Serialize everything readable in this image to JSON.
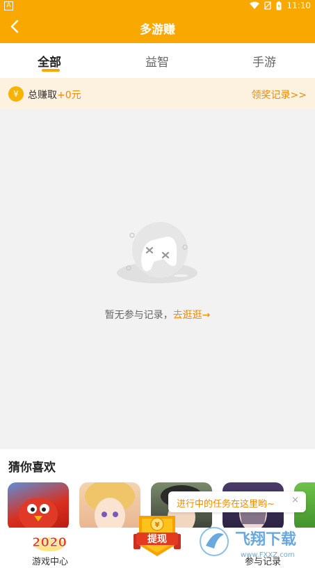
{
  "statusbar": {
    "indicator": "A",
    "time": "11:10"
  },
  "appbar": {
    "title": "多游赚"
  },
  "tabs": [
    {
      "label": "全部"
    },
    {
      "label": "益智"
    },
    {
      "label": "手游"
    }
  ],
  "earn": {
    "coin_symbol": "¥",
    "label": "总赚取",
    "value": "+0元",
    "record_link": "领奖记录>>"
  },
  "empty": {
    "text": "暂无参与记录，",
    "link": "去逛逛→"
  },
  "guess": {
    "title": "猜你喜欢"
  },
  "bottom_nav": {
    "left_label": "游戏中心",
    "left_badge": "2020",
    "center_label": "提现",
    "right_label": "参与记录"
  },
  "tooltip": {
    "text": "进行中的任务在这里哟~",
    "close": "×"
  },
  "watermark": {
    "brand": "飞翔下载",
    "url": "www.FXXZ.com"
  },
  "colors": {
    "primary": "#f8a800",
    "accent": "#f08a00",
    "banner": "#fdf2df"
  }
}
